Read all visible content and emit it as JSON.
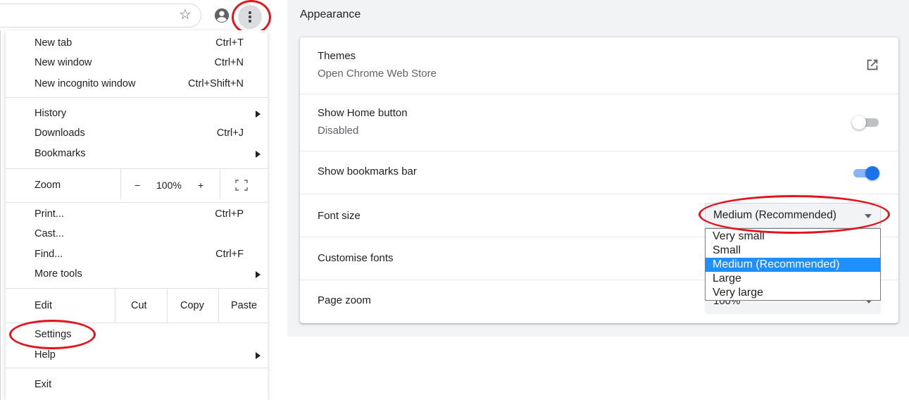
{
  "menu": {
    "items": {
      "new_tab": {
        "label": "New tab",
        "shortcut": "Ctrl+T"
      },
      "new_window": {
        "label": "New window",
        "shortcut": "Ctrl+N"
      },
      "new_incognito": {
        "label": "New incognito window",
        "shortcut": "Ctrl+Shift+N"
      },
      "history": {
        "label": "History"
      },
      "downloads": {
        "label": "Downloads",
        "shortcut": "Ctrl+J"
      },
      "bookmarks": {
        "label": "Bookmarks"
      },
      "print": {
        "label": "Print...",
        "shortcut": "Ctrl+P"
      },
      "cast": {
        "label": "Cast..."
      },
      "find": {
        "label": "Find...",
        "shortcut": "Ctrl+F"
      },
      "more_tools": {
        "label": "More tools"
      },
      "settings": {
        "label": "Settings"
      },
      "help": {
        "label": "Help"
      },
      "exit": {
        "label": "Exit"
      }
    },
    "zoom": {
      "label": "Zoom",
      "minus": "−",
      "value": "100%",
      "plus": "+"
    },
    "edit": {
      "label": "Edit",
      "cut": "Cut",
      "copy": "Copy",
      "paste": "Paste"
    }
  },
  "toolbar": {
    "star_icon": "star-icon",
    "profile_icon": "account-circle-icon",
    "menu_icon": "three-dots-vertical-icon"
  },
  "settings": {
    "section_title": "Appearance",
    "themes": {
      "title": "Themes",
      "subtitle": "Open Chrome Web Store",
      "icon": "open-in-new-icon"
    },
    "home_button": {
      "title": "Show Home button",
      "subtitle": "Disabled",
      "enabled": false
    },
    "bookmarks_bar": {
      "title": "Show bookmarks bar",
      "enabled": true
    },
    "font_size": {
      "title": "Font size",
      "selected": "Medium (Recommended)",
      "options": [
        "Very small",
        "Small",
        "Medium (Recommended)",
        "Large",
        "Very large"
      ]
    },
    "customise_fonts": {
      "title": "Customise fonts"
    },
    "page_zoom": {
      "title": "Page zoom",
      "value": "100%"
    }
  },
  "colors": {
    "accent": "#1a73e8",
    "annotation": "#e3141d",
    "dropdown_highlight": "#1e90ff"
  }
}
